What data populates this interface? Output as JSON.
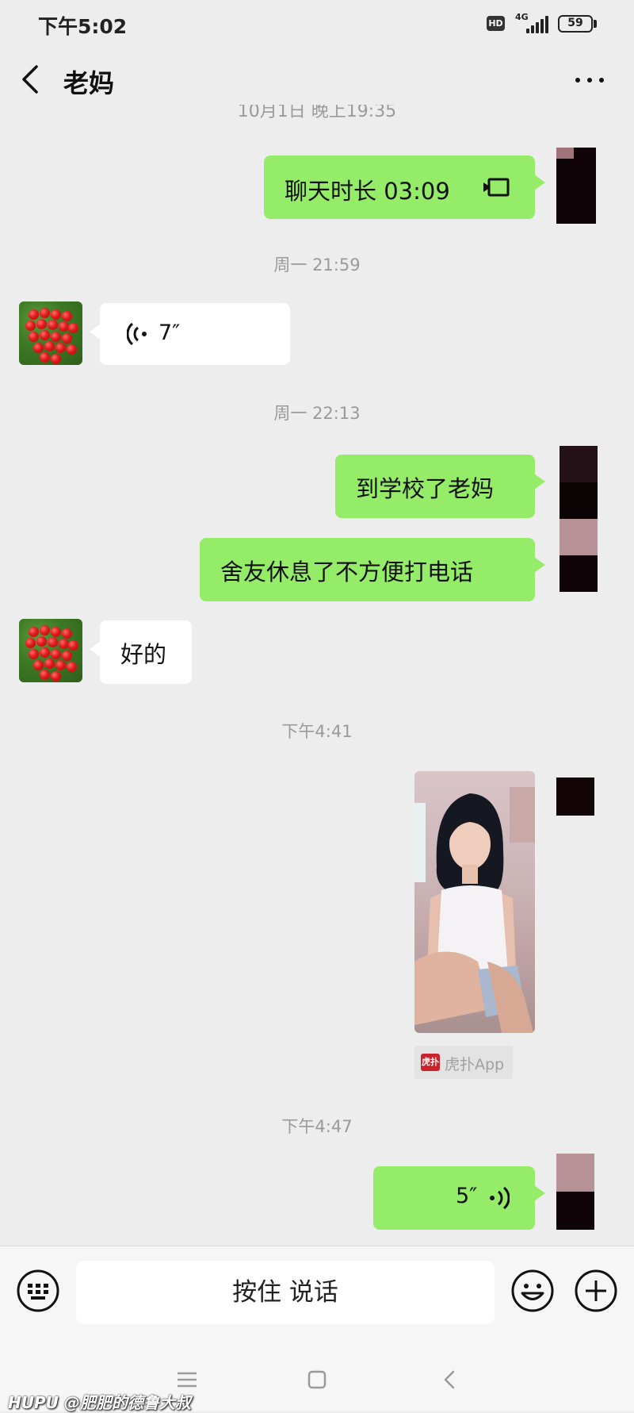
{
  "status_bar": {
    "time": "下午5:02",
    "hd_badge": "HD",
    "network": "4G",
    "battery": "59"
  },
  "header": {
    "title": "老妈",
    "back_icon": "chevron-left-icon",
    "more_icon": "more-dots-icon"
  },
  "messages": {
    "cut_timestamp": "10月1日 晚上19:35",
    "call_duration": "聊天时长 03:09",
    "ts_1": "周一 21:59",
    "mom_voice_duration": "7″",
    "ts_2": "周一 22:13",
    "text_1": "到学校了老妈",
    "text_2": "舍友休息了不方便打电话",
    "mom_reply": "好的",
    "ts_3": "下午4:41",
    "photo_watermark": "虎扑App",
    "ts_4": "下午4:47",
    "my_voice_duration": "5″"
  },
  "input_bar": {
    "hold_to_talk": "按住 说话",
    "voice_toggle_icon": "keyboard-icon",
    "emoji_icon": "emoji-icon",
    "plus_icon": "plus-icon"
  },
  "nav_bar": {
    "menu_icon": "menu-icon",
    "home_icon": "home-icon",
    "back_icon": "back-icon"
  },
  "hupu_tag": "HUPU @肥肥的德鲁大叔",
  "colors": {
    "background": "#ededed",
    "sent_bubble": "#95ec69",
    "received_bubble": "#ffffff",
    "timestamp_text": "#9a9a9a"
  }
}
